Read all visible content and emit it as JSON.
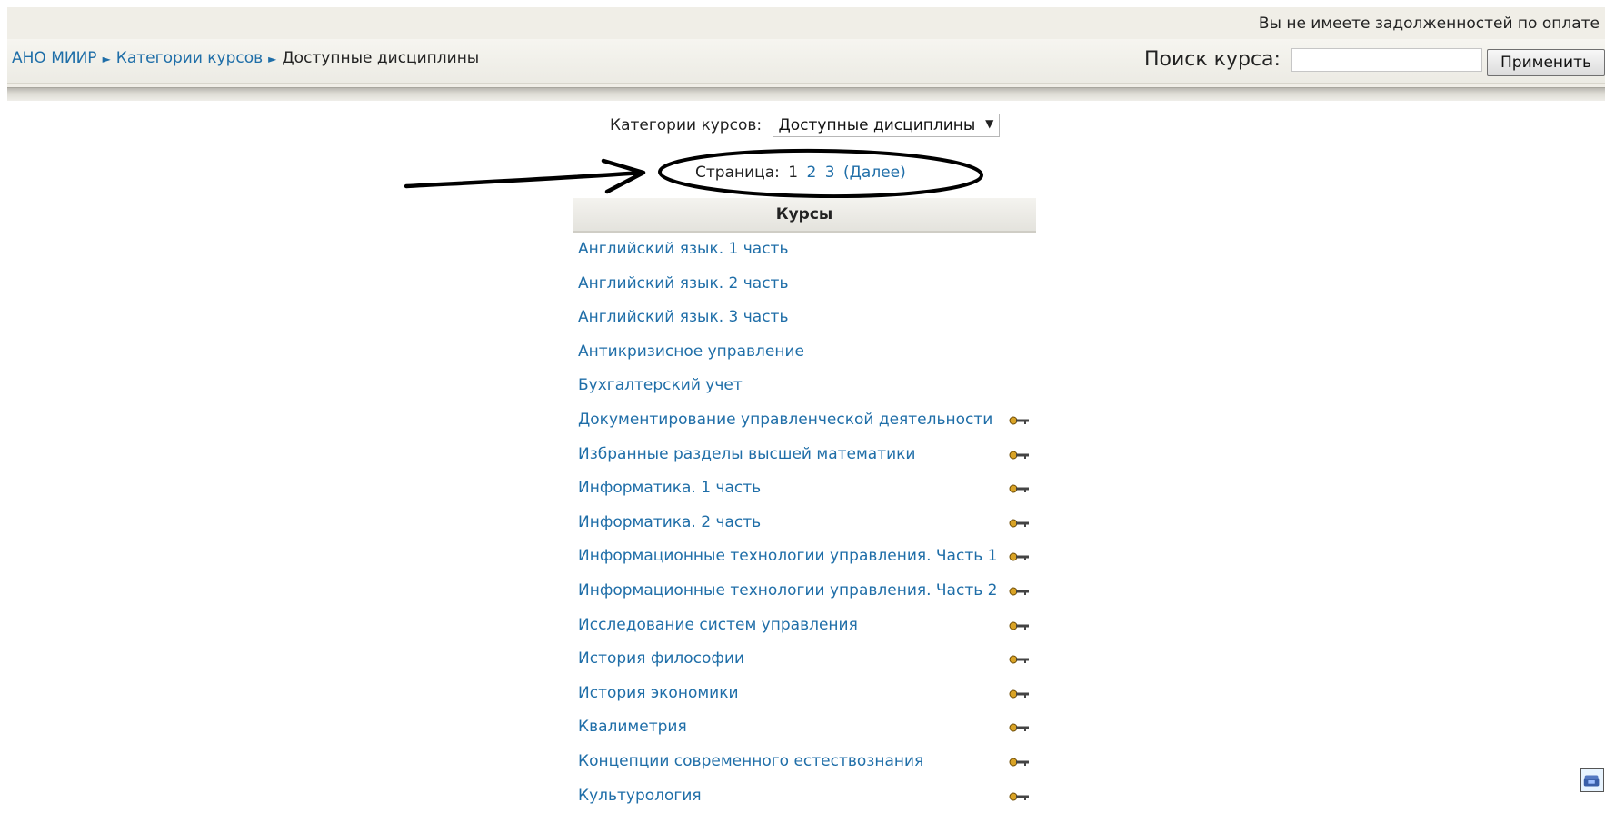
{
  "header": {
    "debt_notice": "Вы не имеете задолженностей по оплате",
    "breadcrumb": {
      "root": "АНО МИИР",
      "categories": "Категории курсов",
      "current": "Доступные дисциплины",
      "separator": "►"
    },
    "search": {
      "label": "Поиск курса:",
      "value": "",
      "button_label": "Применить"
    }
  },
  "category_selector": {
    "label": "Категории курсов:",
    "selected": "Доступные дисциплины",
    "arrow": "▼"
  },
  "pager": {
    "label": "Страница:",
    "current": "1",
    "pages": [
      "2",
      "3"
    ],
    "next_label": "(Далее)"
  },
  "courses": {
    "heading": "Курсы",
    "items": [
      {
        "title": "Английский язык. 1 часть",
        "has_key": false
      },
      {
        "title": "Английский язык. 2 часть",
        "has_key": false
      },
      {
        "title": "Английский язык. 3 часть",
        "has_key": false
      },
      {
        "title": "Антикризисное управление",
        "has_key": false
      },
      {
        "title": "Бухгалтерский учет",
        "has_key": false
      },
      {
        "title": "Документирование управленческой деятельности",
        "has_key": true
      },
      {
        "title": "Избранные разделы высшей математики",
        "has_key": true
      },
      {
        "title": "Информатика. 1 часть",
        "has_key": true
      },
      {
        "title": "Информатика. 2 часть",
        "has_key": true
      },
      {
        "title": "Информационные технологии управления. Часть 1",
        "has_key": true
      },
      {
        "title": "Информационные технологии управления. Часть 2",
        "has_key": true
      },
      {
        "title": "Исследование систем управления",
        "has_key": true
      },
      {
        "title": "История философии",
        "has_key": true
      },
      {
        "title": "История экономики",
        "has_key": true
      },
      {
        "title": "Квалиметрия",
        "has_key": true
      },
      {
        "title": "Концепции современного естествознания",
        "has_key": true
      },
      {
        "title": "Культурология",
        "has_key": true
      }
    ]
  },
  "icons": {
    "course_key": "key-icon",
    "corner_widget": "phone-icon"
  },
  "colors": {
    "link": "#1f6ea8",
    "header_background": "#f0eee7",
    "key_icon": "#d9a326"
  }
}
